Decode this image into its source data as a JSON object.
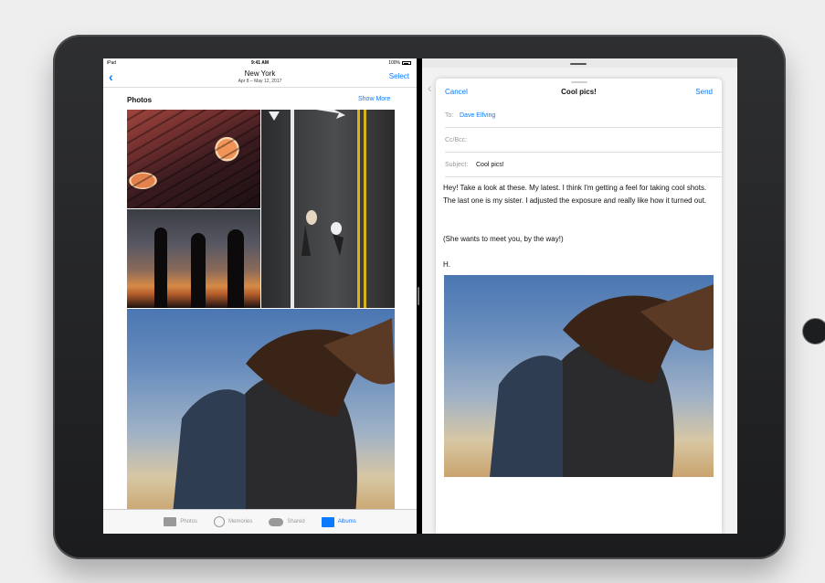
{
  "status_bar": {
    "device": "iPad",
    "time": "9:41 AM",
    "battery": "100%"
  },
  "photos_app": {
    "title": "New York",
    "subtitle": "Apr 8 – May 12, 2017",
    "select_label": "Select",
    "section_title": "Photos",
    "show_more_label": "Show More",
    "tabs": [
      {
        "label": "Photos",
        "icon": "photos-icon",
        "active": false
      },
      {
        "label": "Memories",
        "icon": "memories-icon",
        "active": false
      },
      {
        "label": "Shared",
        "icon": "cloud-icon",
        "active": false
      },
      {
        "label": "Albums",
        "icon": "albums-icon",
        "active": true
      }
    ]
  },
  "compose": {
    "cancel_label": "Cancel",
    "title": "Cool pics!",
    "send_label": "Send",
    "to_label": "To:",
    "to_value": "Dave Elfving",
    "cc_label": "Cc/Bcc:",
    "subject_label": "Subject:",
    "subject_value": "Cool pics!",
    "body_paragraph_1": "Hey! Take a look at these. My latest. I think I'm getting a feel for taking cool shots. The last one is my sister. I adjusted the exposure and really like how it turned out.",
    "body_paragraph_2": "(She wants to meet you, by the way!)",
    "body_signoff": "H."
  },
  "colors": {
    "accent": "#0a7aff",
    "bezel": "#1f2022",
    "background": "#eeeeef"
  }
}
